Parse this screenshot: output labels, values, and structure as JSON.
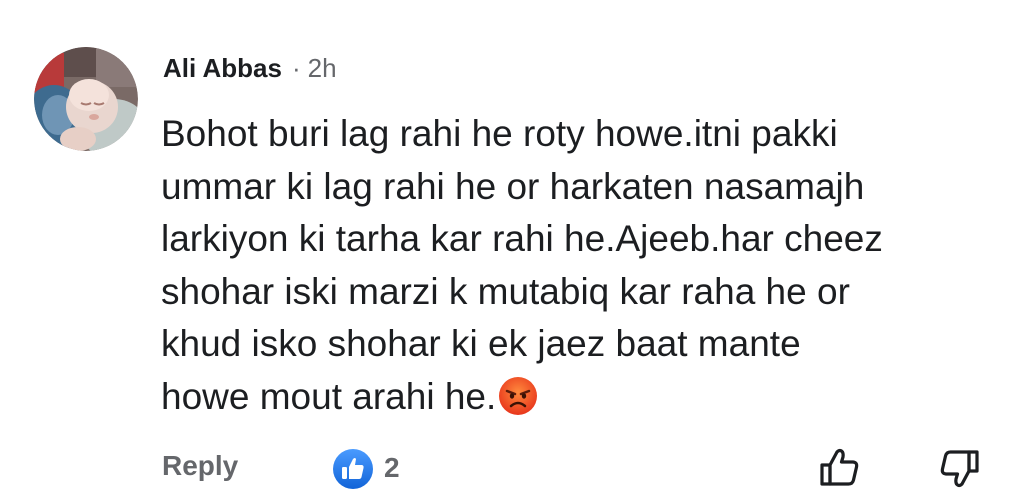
{
  "comment": {
    "author": "Ali Abbas",
    "separator": "·",
    "time": "2h",
    "lines": [
      "Bohot buri lag rahi he roty howe.itni pakki",
      "ummar ki lag rahi he or harkaten nasamajh",
      "larkiyon ki tarha kar rahi he.Ajeeb.har cheez",
      "shohar iski marzi k mutabiq kar raha he or",
      "khud isko shohar ki ek jaez baat mante",
      "howe mout arahi he."
    ],
    "emoji": "angry-face-emoji",
    "avatar": "baby-photo-avatar"
  },
  "actions": {
    "reply_label": "Reply",
    "like_count": "2",
    "like_badge_icon": "like-thumb-icon",
    "upvote_icon": "thumbs-up-icon",
    "downvote_icon": "thumbs-down-icon"
  },
  "colors": {
    "text": "#1c1e21",
    "muted": "#65676b",
    "like_blue": "#1877f2"
  }
}
